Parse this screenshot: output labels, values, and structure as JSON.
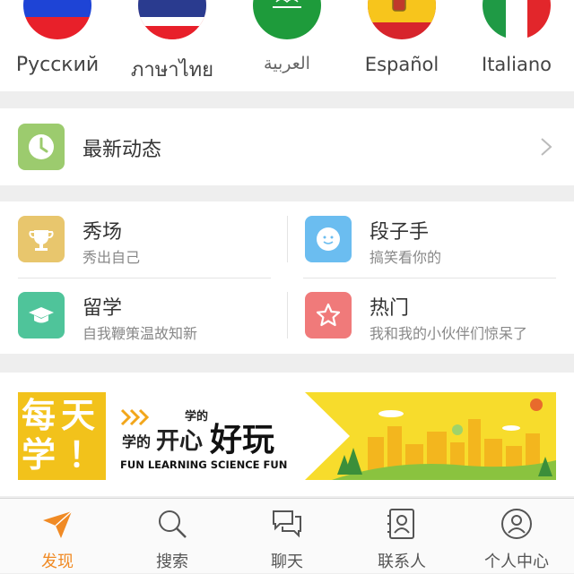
{
  "languages": [
    {
      "label": "Русский"
    },
    {
      "label": "ภาษาไทย"
    },
    {
      "label": "العربية"
    },
    {
      "label": "Español"
    },
    {
      "label": "Italiano"
    }
  ],
  "news": {
    "title": "最新动态",
    "icon": "clock-icon",
    "color": "#9ccb6e"
  },
  "grid": [
    {
      "title": "秀场",
      "subtitle": "秀出自己",
      "icon": "trophy-icon",
      "color": "#e8c66d"
    },
    {
      "title": "段子手",
      "subtitle": "搞笑看你的",
      "icon": "smiley-icon",
      "color": "#6bbdf0"
    },
    {
      "title": "留学",
      "subtitle": "自我鞭策温故知新",
      "icon": "graduation-cap-icon",
      "color": "#4fc49a"
    },
    {
      "title": "热门",
      "subtitle": "我和我的小伙伴们惊呆了",
      "icon": "star-icon",
      "color": "#f07a7a"
    }
  ],
  "banner": {
    "left_chars": [
      "每",
      "天",
      "学",
      "！"
    ],
    "tagline_small": "学的",
    "tagline_main_a": "学的",
    "tagline_main_b": "开心",
    "tagline_main_c": "好玩",
    "english": "FUN LEARNING SCIENCE FUN",
    "colors": {
      "yellow": "#f2c21b",
      "sky": "#f7dc2c"
    }
  },
  "tabs": [
    {
      "label": "发现",
      "icon": "paper-plane-icon",
      "active": true
    },
    {
      "label": "搜索",
      "icon": "search-icon",
      "active": false
    },
    {
      "label": "聊天",
      "icon": "chat-icon",
      "active": false
    },
    {
      "label": "联系人",
      "icon": "contacts-icon",
      "active": false
    },
    {
      "label": "个人中心",
      "icon": "user-icon",
      "active": false
    }
  ],
  "accent_color": "#f08a24"
}
